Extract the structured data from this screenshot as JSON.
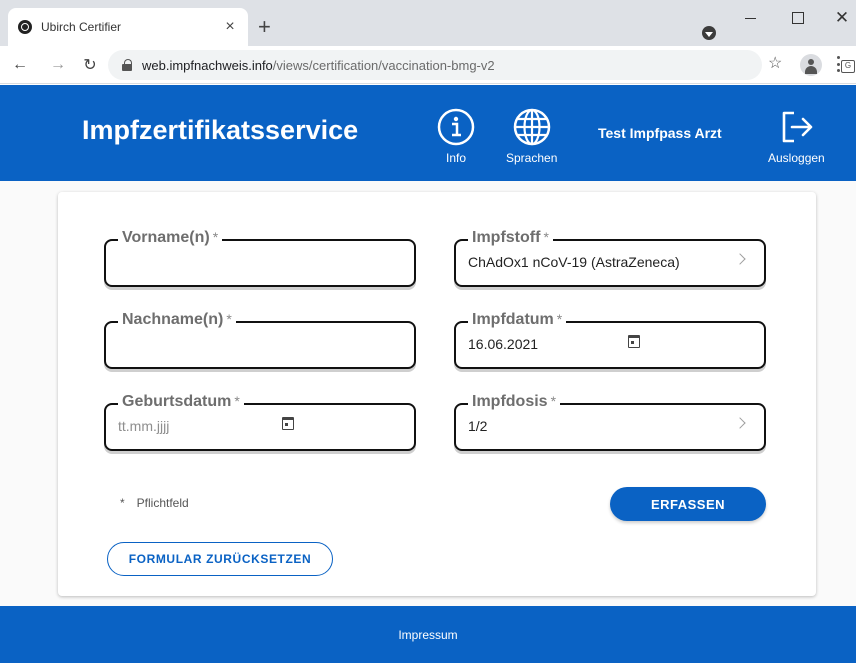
{
  "browser": {
    "tab_title": "Ubirch Certifier",
    "tab_close": "×",
    "new_tab": "+",
    "window_close": "✕",
    "url_host": "web.impfnachweis.info",
    "url_path": "/views/certification/vaccination-bmg-v2"
  },
  "header": {
    "title": "Impfzertifikatsservice",
    "info_label": "Info",
    "language_label": "Sprachen",
    "user_name": "Test Impfpass Arzt",
    "logout_label": "Ausloggen",
    "accent_color": "#0a62c4"
  },
  "form": {
    "vorname": {
      "label": "Vorname(n)",
      "required_mark": "*",
      "value": ""
    },
    "nachname": {
      "label": "Nachname(n)",
      "required_mark": "*",
      "value": ""
    },
    "geburtsdatum": {
      "label": "Geburtsdatum",
      "required_mark": "*",
      "placeholder": "tt.mm.jjjj"
    },
    "impfstoff": {
      "label": "Impfstoff",
      "required_mark": "*",
      "value": "ChAdOx1 nCoV-19 (AstraZeneca)"
    },
    "impfdatum": {
      "label": "Impfdatum",
      "required_mark": "*",
      "value": "16.06.2021"
    },
    "impfdosis": {
      "label": "Impfdosis",
      "required_mark": "*",
      "value": "1/2"
    },
    "required_note_mark": "*",
    "required_note": "Pflichtfeld",
    "submit_label": "ERFASSEN",
    "reset_label": "FORMULAR ZURÜCKSETZEN"
  },
  "footer": {
    "impressum_label": "Impressum"
  }
}
